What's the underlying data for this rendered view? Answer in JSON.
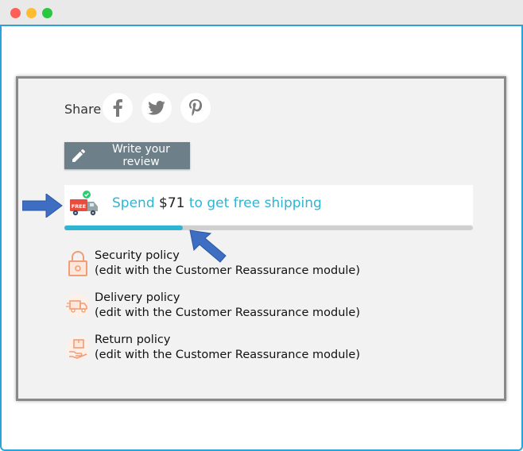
{
  "window": {
    "controls": [
      "close",
      "minimize",
      "maximize"
    ]
  },
  "share": {
    "label": "Share",
    "networks": [
      {
        "name": "facebook",
        "icon": "facebook-icon"
      },
      {
        "name": "twitter",
        "icon": "twitter-icon"
      },
      {
        "name": "pinterest",
        "icon": "pinterest-icon"
      }
    ]
  },
  "review": {
    "button_label": "Write your review",
    "icon": "pencil-icon"
  },
  "shipping": {
    "prefix": "Spend ",
    "amount": "$71",
    "suffix": " to get free shipping",
    "badge_text": "FREE",
    "progress_fraction": 0.29,
    "accent_color": "#2fb5d2"
  },
  "reassurance": [
    {
      "title": "Security policy",
      "subtitle": "(edit with the Customer Reassurance module)",
      "icon": "lock-icon"
    },
    {
      "title": "Delivery policy",
      "subtitle": "(edit with the Customer Reassurance module)",
      "icon": "delivery-truck-icon"
    },
    {
      "title": "Return policy",
      "subtitle": "(edit with the Customer Reassurance module)",
      "icon": "return-box-icon"
    }
  ],
  "annotation_color": "#3e6ec2"
}
